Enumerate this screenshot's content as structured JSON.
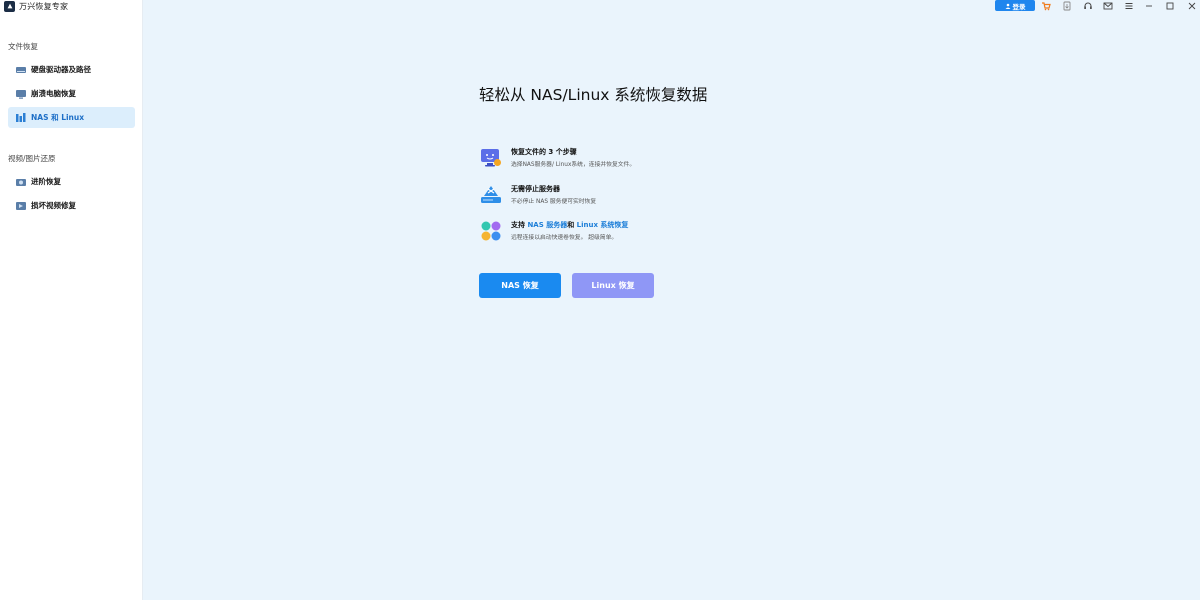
{
  "app": {
    "title": "万兴恢复专家"
  },
  "sidebar": {
    "sections": [
      {
        "label": "文件恢复",
        "items": [
          {
            "label": "硬盘驱动器及路径",
            "icon": "hard-drive-icon"
          },
          {
            "label": "崩溃电脑恢复",
            "icon": "monitor-icon"
          },
          {
            "label": "NAS 和 Linux",
            "icon": "nas-icon",
            "active": true
          }
        ]
      },
      {
        "label": "视频/图片还原",
        "items": [
          {
            "label": "进阶恢复",
            "icon": "camera-icon"
          },
          {
            "label": "损坏视频修复",
            "icon": "video-repair-icon"
          }
        ]
      }
    ]
  },
  "topbar": {
    "login_label": "登录",
    "icons": [
      "cart-icon",
      "export-icon",
      "headset-icon",
      "mail-icon",
      "menu-icon",
      "minimize-icon",
      "maximize-icon",
      "close-icon"
    ]
  },
  "main": {
    "headline": "轻松从 NAS/Linux 系统恢复数据",
    "features": [
      {
        "title_parts": [
          "恢复文件的 3 个步骤"
        ],
        "desc": "选择NAS服务器/ Linux系统，连接并恢复文件。"
      },
      {
        "title_parts": [
          "无需停止服务器"
        ],
        "desc": "不必停止 NAS 服务便可实时恢复"
      },
      {
        "title_prefix": "支持 ",
        "title_hl1": "NAS 服务器",
        "title_mid": "和 ",
        "title_hl2": "Linux 系统恢复",
        "desc": "远程连接以启动快速卷恢复。 超级简单。"
      }
    ],
    "buttons": {
      "nas": "NAS 恢复",
      "linux": "Linux 恢复"
    }
  },
  "colors": {
    "accent": "#1a8af0",
    "linux_button": "#8f97f6",
    "main_bg": "#eaf4fc",
    "active_nav_bg": "#dceefc"
  }
}
